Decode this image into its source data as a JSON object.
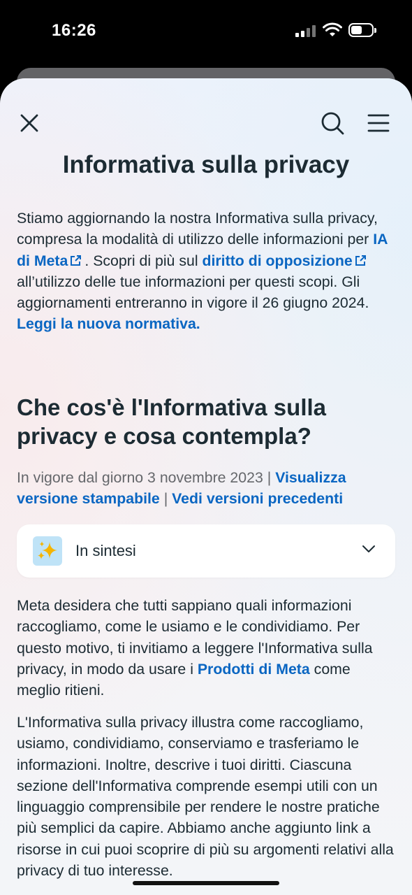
{
  "status": {
    "time": "16:26"
  },
  "header": {
    "title": "Informativa sulla privacy"
  },
  "intro": {
    "t1": "Stiamo aggiornando la nostra Informativa sulla privacy, compresa la modalità di utilizzo delle informazioni per ",
    "link1": "IA di Meta",
    "t2": ". Scopri di più sul ",
    "link2": "diritto di opposizione",
    "t3": " all’utilizzo delle tue informazioni per questi scopi. Gli aggiornamenti entreranno in vigore il 26 giugno 2024. ",
    "link3": "Leggi la nuova normativa."
  },
  "section": {
    "heading": "Che cos'è l'Informativa sulla privacy e cosa contempla?",
    "effective": "In vigore dal giorno 3 novembre 2023 | ",
    "printable_link": "Visualizza versione stampabile",
    "separator": " | ",
    "previous_link": "Vedi versioni precedenti"
  },
  "summary": {
    "label": "In sintesi",
    "icon": "sparkles-icon"
  },
  "body": {
    "p1_a": "Meta desidera che tutti sappiano quali informazioni raccogliamo, come le usiamo e le condividiamo. Per questo motivo, ti invitiamo a leggere l'Informativa sulla privacy, in modo da usare i ",
    "p1_link": "Prodotti di Meta",
    "p1_b": " come meglio ritieni.",
    "p2": "L'Informativa sulla privacy illustra come raccogliamo, usiamo, condividiamo, conserviamo e trasferiamo le informazioni. Inoltre, descrive i tuoi diritti. Ciascuna sezione dell'Informativa comprende esempi utili con un linguaggio comprensibile per rendere le nostre pratiche più semplici da capire. Abbiamo anche aggiunto link a risorse in cui puoi scoprire di più su argomenti relativi alla privacy di tuo interesse."
  },
  "colors": {
    "link": "#0a66c2",
    "text": "#1c2b33",
    "muted": "#65676b"
  }
}
